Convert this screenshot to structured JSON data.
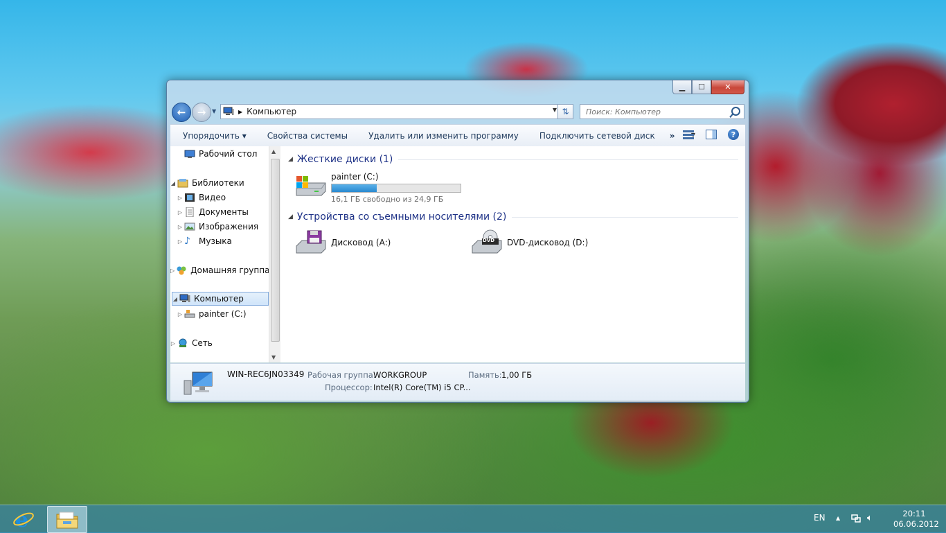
{
  "window": {
    "address": {
      "location": "Компьютер"
    },
    "search": {
      "placeholder": "Поиск: Компьютер"
    },
    "caption_buttons": {
      "minimize": "▁",
      "maximize": "☐",
      "close": "✕"
    },
    "toolbar": {
      "organize": "Упорядочить ▾",
      "system_properties": "Свойства системы",
      "uninstall_program": "Удалить или изменить программу",
      "map_network_drive": "Подключить сетевой диск",
      "more": "»"
    },
    "navpane": {
      "desktop": "Рабочий стол",
      "libraries": "Библиотеки",
      "video": "Видео",
      "documents": "Документы",
      "images": "Изображения",
      "music": "Музыка",
      "homegroup": "Домашняя группа",
      "computer": "Компьютер",
      "drive_c": "painter (C:)",
      "network": "Сеть"
    },
    "groups": {
      "hard_drives": "Жесткие диски (1)",
      "removable": "Устройства со съемными носителями (2)"
    },
    "drives": {
      "c": {
        "name": "painter (C:)",
        "free_text": "16,1 ГБ свободно из 24,9 ГБ",
        "used_fraction": 0.35
      },
      "a": {
        "name": "Дисковод (A:)"
      },
      "d": {
        "name": "DVD-дисковод (D:)",
        "badge": "DVD"
      }
    },
    "details": {
      "computer_name": "WIN-REC6JN03349",
      "workgroup_label": "Рабочая группа:",
      "workgroup_value": "WORKGROUP",
      "memory_label": "Память:",
      "memory_value": "1,00 ГБ",
      "cpu_label": "Процессор:",
      "cpu_value": "Intel(R) Core(TM) i5 CP..."
    }
  },
  "taskbar": {
    "language": "EN",
    "time": "20:11",
    "date": "06.06.2012",
    "apps": [
      "internet-explorer",
      "file-explorer"
    ]
  },
  "colors": {
    "group_header": "#1e3287",
    "drive_fill": "#2a89cf",
    "selection": "#cfe4fa"
  }
}
